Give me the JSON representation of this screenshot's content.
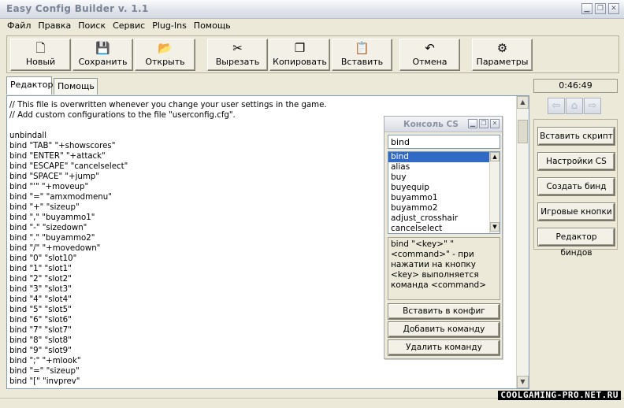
{
  "window": {
    "title": "Easy Config Builder v. 1.1",
    "controls": {
      "minimize": "▁",
      "restore": "❐",
      "close": "✕"
    }
  },
  "menu": [
    "Файл",
    "Правка",
    "Поиск",
    "Сервис",
    "Plug-Ins",
    "Помощь"
  ],
  "toolbar": {
    "new": {
      "label": "Новый",
      "icon": "new-file-icon"
    },
    "save": {
      "label": "Сохранить",
      "icon": "floppy-disk-icon"
    },
    "open": {
      "label": "Открыть",
      "icon": "open-folder-icon"
    },
    "cut": {
      "label": "Вырезать",
      "icon": "scissors-icon"
    },
    "copy": {
      "label": "Копировать",
      "icon": "copy-icon"
    },
    "paste": {
      "label": "Вставить",
      "icon": "paste-icon"
    },
    "undo": {
      "label": "Отмена",
      "icon": "undo-icon"
    },
    "settings": {
      "label": "Параметры",
      "icon": "settings-icon"
    }
  },
  "tabs": [
    "Редактор",
    "Помощь"
  ],
  "editor": {
    "lines": [
      "// This file is overwritten whenever you change your user settings in the game.",
      "// Add custom configurations to the file \"userconfig.cfg\".",
      "",
      "unbindall",
      "bind \"TAB\" \"+showscores\"",
      "bind \"ENTER\" \"+attack\"",
      "bind \"ESCAPE\" \"cancelselect\"",
      "bind \"SPACE\" \"+jump\"",
      "bind \"'\" \"+moveup\"",
      "bind \"=\" \"amxmodmenu\"",
      "bind \"+\" \"sizeup\"",
      "bind \",\" \"buyammo1\"",
      "bind \"-\" \"sizedown\"",
      "bind \".\" \"buyammo2\"",
      "bind \"/\" \"+movedown\"",
      "bind \"0\" \"slot10\"",
      "bind \"1\" \"slot1\"",
      "bind \"2\" \"slot2\"",
      "bind \"3\" \"slot3\"",
      "bind \"4\" \"slot4\"",
      "bind \"5\" \"slot5\"",
      "bind \"6\" \"slot6\"",
      "bind \"7\" \"slot7\"",
      "bind \"8\" \"slot8\"",
      "bind \"9\" \"slot9\"",
      "bind \";\" \"+mlook\"",
      "bind \"=\" \"sizeup\"",
      "bind \"[\" \"invprev\""
    ]
  },
  "console": {
    "title": "Консоль CS",
    "search_value": "bind",
    "items": [
      "bind",
      "alias",
      "buy",
      "buyequip",
      "buyammo1",
      "buyammo2",
      "adjust_crosshair",
      "cancelselect"
    ],
    "selected": "bind",
    "description": "bind \"<key>\" \"<command>\" - при нажатии на кнопку <key> выполняется команда <command>",
    "buttons": [
      "Вставить в конфиг",
      "Добавить команду",
      "Удалить команду"
    ]
  },
  "clock": "0:46:49",
  "side_buttons": [
    "Вставить скрипт",
    "Настройки CS",
    "Создать бинд",
    "Игровые кнопки",
    "Редактор биндов"
  ],
  "watermark": "COOLGAMING-PRO.NET.RU"
}
